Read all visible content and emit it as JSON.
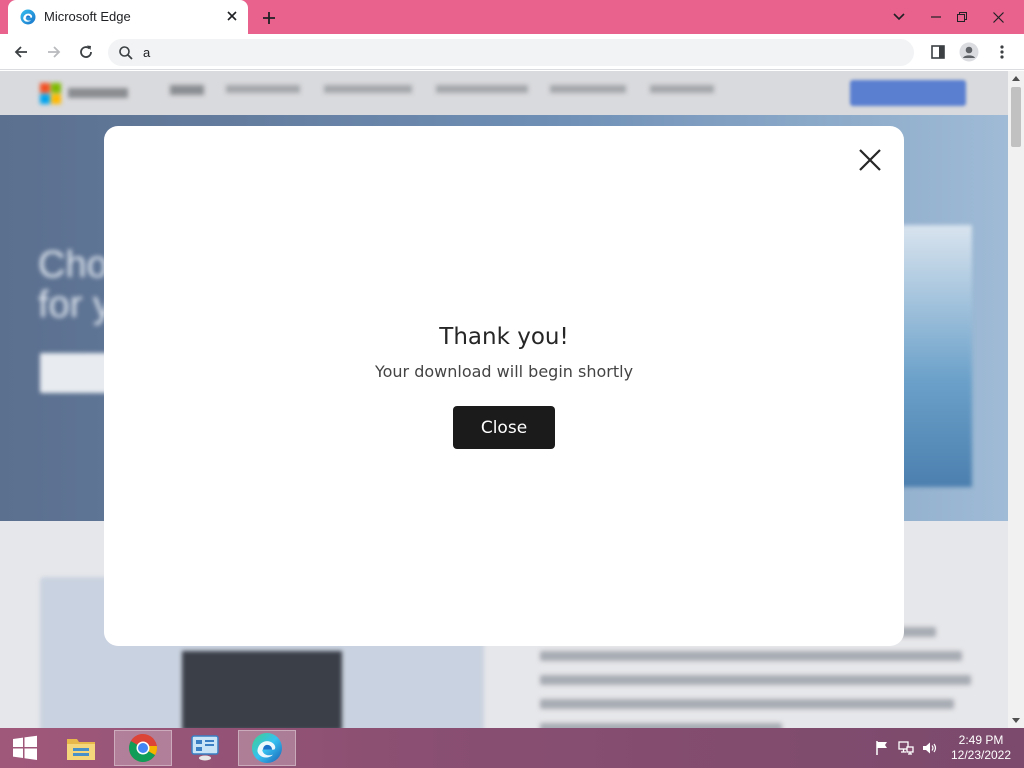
{
  "browser": {
    "tab": {
      "title": "Microsoft Edge",
      "favicon": "edge-logo-icon"
    },
    "new_tab_icon": "plus-icon",
    "window_controls": [
      "chevron-down-icon",
      "minimize-icon",
      "restore-icon",
      "close-icon"
    ],
    "omnibox": {
      "value": "a",
      "icon": "search-icon"
    },
    "toolbar_icons": [
      "back-arrow-icon",
      "forward-arrow-icon",
      "reload-icon",
      "side-panel-icon",
      "profile-icon",
      "more-menu-icon"
    ]
  },
  "dialog": {
    "title": "Thank you!",
    "message": "Your download will begin shortly",
    "close_button_label": "Close",
    "close_icon": "close-x-icon"
  },
  "taskbar": {
    "start_icon": "windows-start-icon",
    "apps": [
      "file-explorer-icon",
      "chrome-icon",
      "control-panel-icon",
      "edge-icon"
    ],
    "tray_icons": [
      "action-center-flag-icon",
      "network-icon",
      "volume-icon"
    ],
    "clock": {
      "time": "2:49 PM",
      "date": "12/23/2022"
    }
  },
  "colors": {
    "tab_strip": "#e8628d",
    "dialog_button": "#1b1b1b",
    "taskbar": "#8a4f72"
  }
}
